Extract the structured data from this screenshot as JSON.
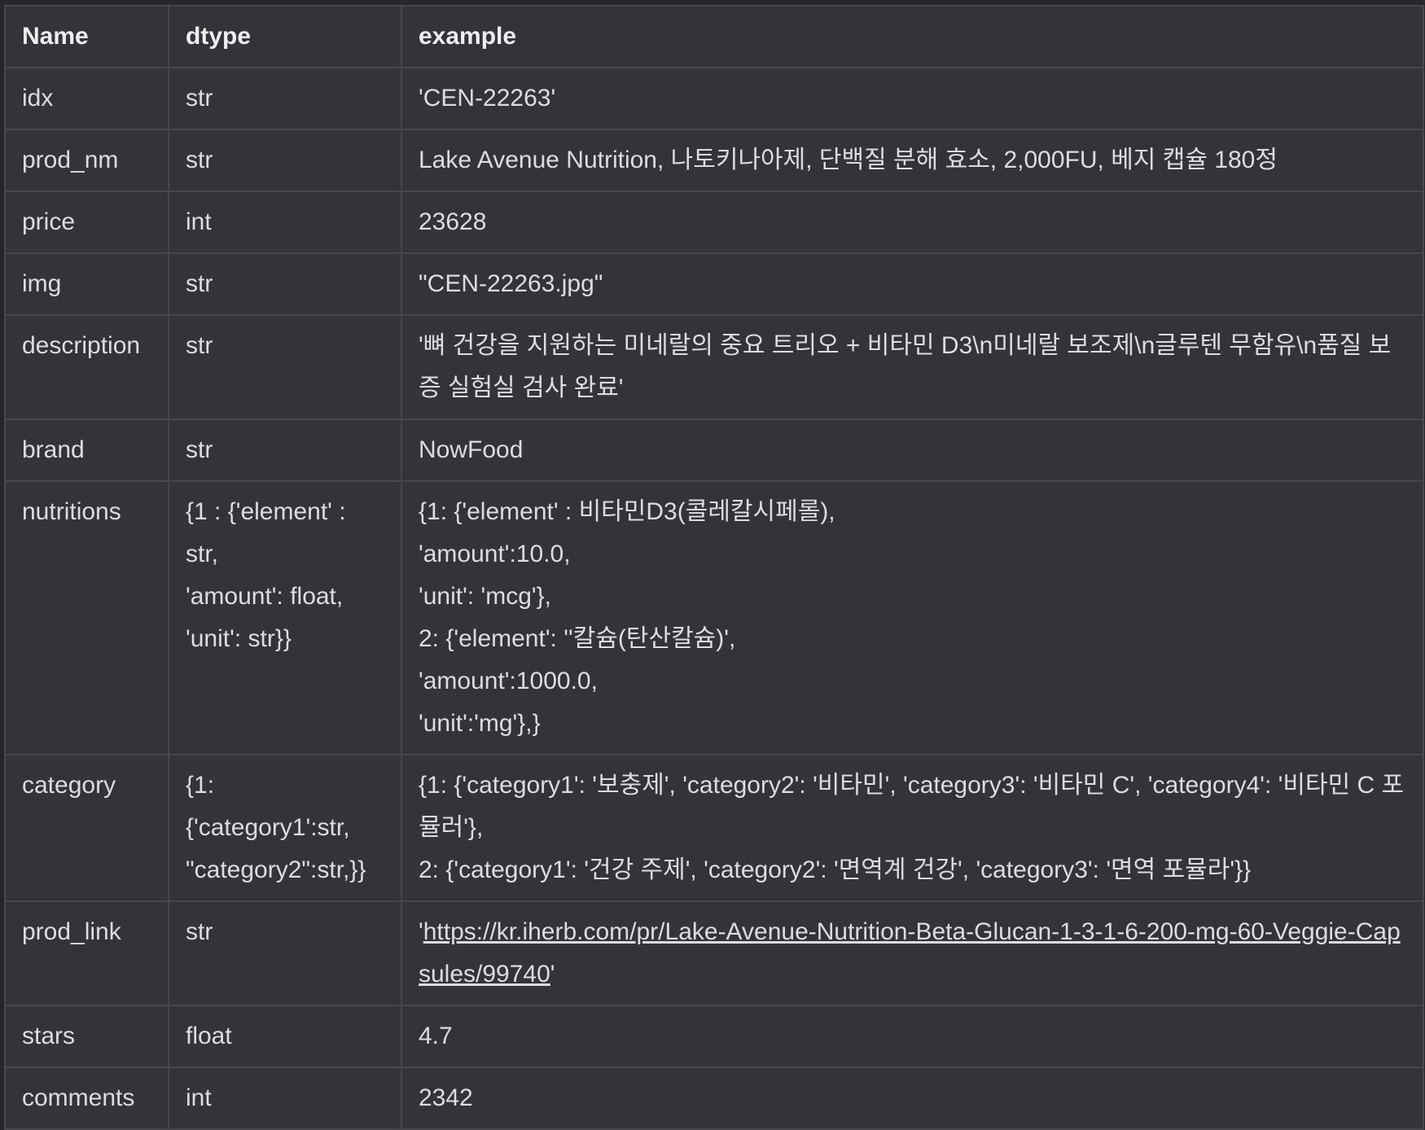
{
  "table": {
    "headers": [
      "Name",
      "dtype",
      "example"
    ],
    "rows": [
      {
        "name": "idx",
        "dtype": "str",
        "example": "'CEN-22263'"
      },
      {
        "name": "prod_nm",
        "dtype": "str",
        "example": "Lake Avenue Nutrition, 나토키나아제, 단백질 분해 효소, 2,000FU, 베지 캡슐 180정"
      },
      {
        "name": "price",
        "dtype": "int",
        "example": "23628"
      },
      {
        "name": "img",
        "dtype": "str",
        "example": "\"CEN-22263.jpg\""
      },
      {
        "name": "description",
        "dtype": "str",
        "example": "'뼈 건강을 지원하는 미네랄의 중요 트리오 + 비타민 D3\\n미네랄 보조제\\n글루텐 무함유\\n품질 보증 실험실 검사 완료'"
      },
      {
        "name": "brand",
        "dtype": "str",
        "example": "NowFood"
      },
      {
        "name": "nutritions",
        "dtype": "{1 : {'element' :\nstr,\n'amount': float,\n'unit': str}}",
        "example": "{1: {'element' : 비타민D3(콜레칼시페롤),\n'amount':10.0,\n'unit': 'mcg'},\n2: {'element': ''칼슘(탄산칼슘)',\n'amount':1000.0,\n'unit':'mg'},}"
      },
      {
        "name": "category",
        "dtype": "{1:\n{'category1':str,\n\"category2\":str,}}",
        "example": "{1: {'category1': '보충제', 'category2': '비타민', 'category3': '비타민 C', 'category4': '비타민 C 포뮬러'},\n2: {'category1': '건강 주제', 'category2': '면역계 건강', 'category3': '면역 포뮬라'}}"
      },
      {
        "name": "prod_link",
        "dtype": "str",
        "example_prefix": "'",
        "example_link": "https://kr.iherb.com/pr/Lake-Avenue-Nutrition-Beta-Glucan-1-3-1-6-200-mg-60-Veggie-Capsules/99740",
        "example_suffix": "'"
      },
      {
        "name": "stars",
        "dtype": "float",
        "example": "4.7"
      },
      {
        "name": "comments",
        "dtype": "int",
        "example": "2342"
      }
    ]
  }
}
